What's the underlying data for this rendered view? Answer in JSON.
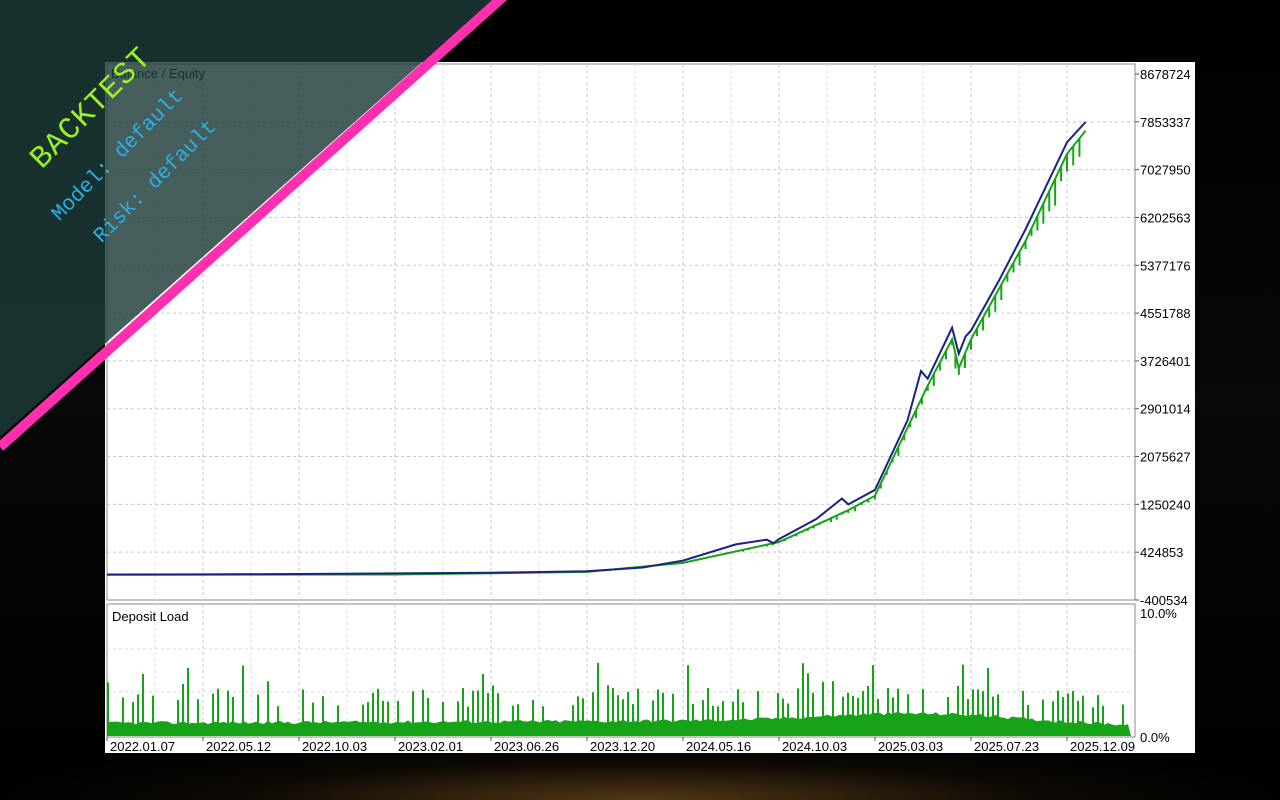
{
  "banner": {
    "title": "BACKTEST",
    "model_line": "Model: default",
    "risk_line": "Risk: default",
    "colors": {
      "panel": "#1d3a38",
      "stripe": "#ff2fb0",
      "title": "#9cf02a",
      "sub": "#2ab0e8"
    }
  },
  "chart_data": [
    {
      "type": "line",
      "title": "Balance / Equity",
      "y_ticks": [
        "8678724",
        "7853337",
        "7027950",
        "6202563",
        "5377176",
        "4551788",
        "3726401",
        "2901014",
        "2075627",
        "1250240",
        "424853",
        "-400534"
      ],
      "ylim": [
        -400534,
        8678724
      ],
      "grid": true,
      "x_tick_labels": [
        "2022.01.07",
        "2022.05.12",
        "2022.10.03",
        "2023.02.01",
        "2023.06.26",
        "2023.12.20",
        "2024.05.16",
        "2024.10.03",
        "2025.03.03",
        "2025.07.23",
        "2025.12.09"
      ],
      "series": [
        {
          "name": "Balance",
          "color": "#1a237e",
          "x": [
            "2022.01.07",
            "2022.05.12",
            "2022.10.03",
            "2023.02.01",
            "2023.06.26",
            "2023.12.20",
            "2024.03.15",
            "2024.05.16",
            "2024.08.01",
            "2024.09.15",
            "2024.09.25",
            "2024.10.03",
            "2024.12.01",
            "2025.01.10",
            "2025.01.20",
            "2025.03.03",
            "2025.04.20",
            "2025.05.10",
            "2025.05.20",
            "2025.06.25",
            "2025.07.05",
            "2025.07.15",
            "2025.07.23",
            "2025.09.01",
            "2025.10.10",
            "2025.12.09",
            "2026.01.05"
          ],
          "values": [
            40000,
            42000,
            48000,
            58000,
            70000,
            95000,
            160000,
            280000,
            560000,
            640000,
            580000,
            650000,
            1000000,
            1350000,
            1250000,
            1500000,
            2700000,
            3550000,
            3420000,
            4300000,
            3850000,
            4150000,
            4250000,
            5100000,
            6000000,
            7500000,
            7850000
          ]
        },
        {
          "name": "Equity",
          "color": "#17a317",
          "x": [
            "2022.01.07",
            "2023.02.01",
            "2023.12.20",
            "2024.05.16",
            "2024.10.03",
            "2025.01.20",
            "2025.03.03",
            "2025.05.20",
            "2025.06.25",
            "2025.07.05",
            "2025.07.23",
            "2025.10.10",
            "2025.12.09",
            "2026.01.05"
          ],
          "values": [
            35000,
            40000,
            85000,
            240000,
            600000,
            1150000,
            1400000,
            3300000,
            4100000,
            3600000,
            4100000,
            5800000,
            7300000,
            7700000
          ]
        }
      ]
    },
    {
      "type": "bar",
      "title": "Deposit Load",
      "y_ticks": [
        "10.0%",
        "0.0%"
      ],
      "ylim": [
        0,
        10
      ],
      "grid": true,
      "series": [
        {
          "name": "Deposit Load",
          "color": "#17a317"
        }
      ]
    }
  ]
}
